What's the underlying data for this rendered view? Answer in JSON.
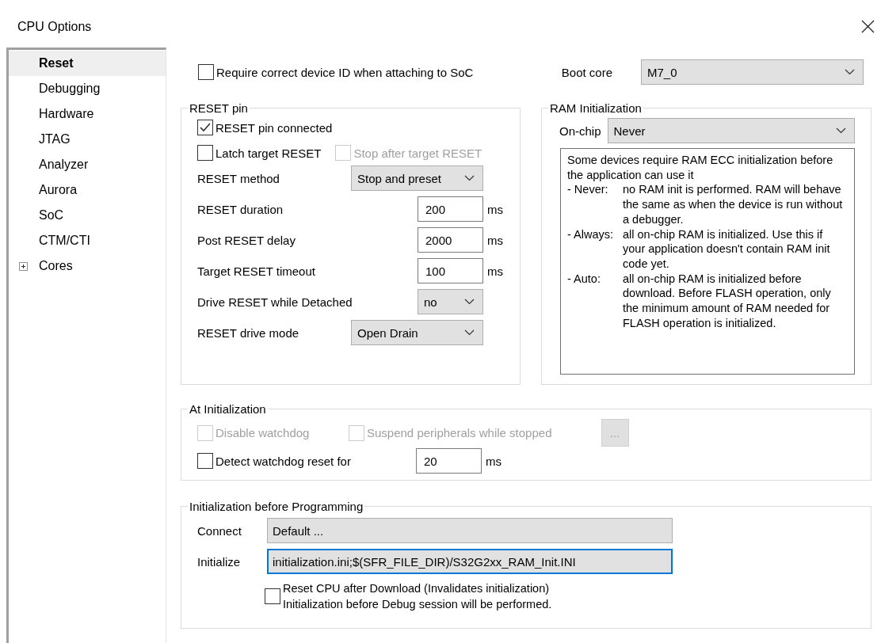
{
  "window": {
    "title": "CPU Options"
  },
  "sidebar": {
    "items": [
      {
        "label": "Reset",
        "selected": true,
        "kind": "page"
      },
      {
        "label": "Debugging",
        "selected": false,
        "kind": "page"
      },
      {
        "label": "Hardware",
        "selected": false,
        "kind": "page"
      },
      {
        "label": "JTAG",
        "selected": false,
        "kind": "page"
      },
      {
        "label": "Analyzer",
        "selected": false,
        "kind": "page"
      },
      {
        "label": "Aurora",
        "selected": false,
        "kind": "page"
      },
      {
        "label": "SoC",
        "selected": false,
        "kind": "page"
      },
      {
        "label": "CTM/CTI",
        "selected": false,
        "kind": "page"
      },
      {
        "label": "Cores",
        "selected": false,
        "kind": "folder",
        "expanded": false
      }
    ]
  },
  "device_id": {
    "label": "Require correct device ID when attaching to SoC",
    "checked": false
  },
  "boot_core": {
    "label": "Boot core",
    "value": "M7_0"
  },
  "reset_pin": {
    "title": "RESET pin",
    "checkbox_rows": [
      [
        {
          "label": "RESET pin connected",
          "checked": true,
          "disabled": false
        }
      ],
      [
        {
          "label": "Latch target RESET",
          "checked": false,
          "disabled": false
        },
        {
          "label": "Stop after target RESET",
          "checked": false,
          "disabled": true
        }
      ]
    ],
    "fields": [
      {
        "kind": "combo",
        "label": "RESET method",
        "value": "Stop and preset"
      },
      {
        "kind": "number",
        "label": "RESET duration",
        "value": "200",
        "unit": "ms"
      },
      {
        "kind": "number",
        "label": "Post RESET delay",
        "value": "2000",
        "unit": "ms"
      },
      {
        "kind": "number",
        "label": "Target RESET timeout",
        "value": "100",
        "unit": "ms"
      },
      {
        "kind": "choice",
        "label": "Drive RESET while Detached",
        "value": "no"
      },
      {
        "kind": "combo",
        "label": "RESET drive mode",
        "value": "Open Drain"
      }
    ]
  },
  "ram_init": {
    "title": "RAM Initialization",
    "label": "On-chip",
    "value": "Never",
    "intro": "Some devices require RAM ECC initialization before the application can use it",
    "options": [
      {
        "term": "- Never:",
        "text": "no RAM init is performed. RAM will behave the same as when the device is run without a debugger."
      },
      {
        "term": "- Always:",
        "text": "all on-chip RAM is initialized. Use this if your application doesn't contain RAM init code yet."
      },
      {
        "term": "- Auto:",
        "text": "all on-chip RAM is initialized before download. Before FLASH operation, only the minimum amount of RAM needed for FLASH operation is initialized."
      }
    ]
  },
  "at_init": {
    "title": "At Initialization",
    "checkboxes": [
      {
        "label": "Disable watchdog",
        "checked": false,
        "disabled": true
      },
      {
        "label": "Suspend peripherals while stopped",
        "checked": false,
        "disabled": true
      }
    ],
    "more_button": {
      "label": "...",
      "disabled": true
    },
    "watchdog": {
      "label": "Detect watchdog reset for",
      "checked": false,
      "value": "20",
      "unit": "ms"
    }
  },
  "init_programming": {
    "title": "Initialization before Programming",
    "fields": [
      {
        "label": "Connect",
        "value": "Default ...",
        "focused": false
      },
      {
        "label": "Initialize",
        "value": "initialization.ini;$(SFR_FILE_DIR)/S32G2xx_RAM_Init.INI",
        "focused": true
      }
    ],
    "reset_cpu": {
      "checked": false,
      "lines": [
        "Reset CPU after Download (Invalidates initialization)",
        "Initialization before Debug session will be performed."
      ]
    }
  }
}
